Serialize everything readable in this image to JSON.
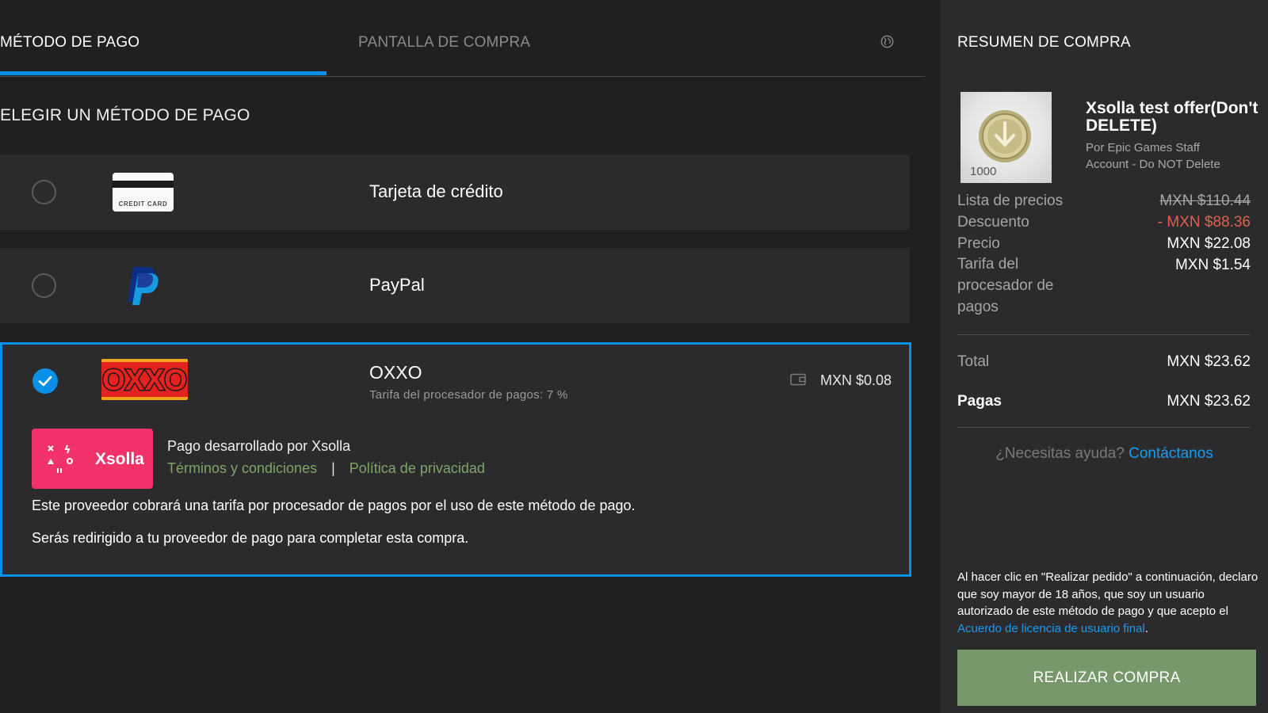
{
  "tabs": {
    "payment_method": "MÉTODO DE PAGO",
    "purchase_screen": "PANTALLA DE COMPRA"
  },
  "icons": {
    "globe": "globe-icon",
    "credit_card": "credit-card-icon",
    "paypal": "paypal-logo",
    "oxxo": "oxxo-logo",
    "wallet": "wallet-icon",
    "xsolla": "xsolla-logo",
    "check": "check-icon",
    "coin": "coin-icon"
  },
  "section_title": "ELEGIR UN MÉTODO DE PAGO",
  "payment_methods": [
    {
      "label": "Tarjeta de crédito",
      "logo_text": "CREDIT CARD",
      "selected": false
    },
    {
      "label": "PayPal",
      "selected": false
    },
    {
      "label": "OXXO",
      "selected": true,
      "logo_text": "OXXO",
      "fee_text": "Tarifa del procesador de pagos: 7 %",
      "amount": "MXN $0.08",
      "provider": {
        "name": "Xsolla",
        "powered_by": "Pago desarrollado por Xsolla",
        "terms": "Términos y condiciones",
        "separator": "|",
        "privacy": "Política de privacidad"
      },
      "notes": [
        "Este proveedor cobrará una tarifa por procesador de pagos por el uso de este método de pago.",
        "Serás redirigido a tu proveedor de pago para completar esta compra."
      ]
    }
  ],
  "summary": {
    "title": "RESUMEN DE COMPRA",
    "product": {
      "thumb_qty": "1000",
      "name": "Xsolla test offer(Don't DELETE)",
      "seller": "Por Epic Games Staff Account - Do NOT Delete"
    },
    "lines": {
      "list_price_label": "Lista de precios",
      "list_price_value": "MXN $110.44",
      "discount_label": "Descuento",
      "discount_value": "- MXN $88.36",
      "price_label": "Precio",
      "price_value": "MXN $22.08",
      "fee_label": "Tarifa del procesador de pagos",
      "fee_value": "MXN $1.54",
      "total_label": "Total",
      "total_value": "MXN $23.62",
      "paid_label": "Pagas",
      "paid_value": "MXN $23.62"
    },
    "help_text": "¿Necesitas ayuda?",
    "help_link": "Contáctanos",
    "legal_text": "Al hacer clic en \"Realizar pedido\" a continuación, declaro que soy mayor de 18 años, que soy un usuario autorizado de este método de pago y que acepto el",
    "legal_link": "Acuerdo de licencia de usuario final",
    "legal_end": ".",
    "cta": "REALIZAR COMPRA"
  },
  "colors": {
    "accent": "#0a8fe6",
    "link": "#1a9bef",
    "discount": "#e0604e",
    "cta": "#77986a",
    "xsolla": "#f2336a",
    "green_link": "#7fa56a"
  }
}
